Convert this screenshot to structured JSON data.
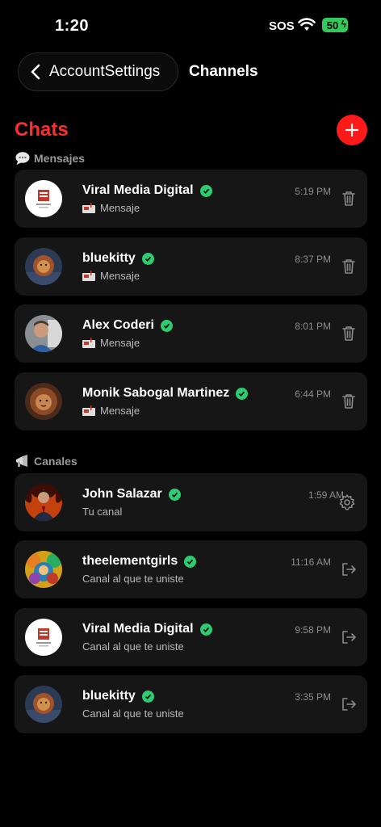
{
  "status_bar": {
    "time": "1:20",
    "carrier": "SOS",
    "battery": "50"
  },
  "header": {
    "back_label": "AccountSettings",
    "title": "Channels"
  },
  "page_title": "Chats",
  "sections": {
    "messages_label": "Mensajes",
    "channels_label": "Canales"
  },
  "messages": [
    {
      "name": "Viral Media Digital",
      "subtitle": "Mensaje",
      "time": "5:19 PM",
      "avatar": "viral-media-logo",
      "action": "trash-icon"
    },
    {
      "name": "bluekitty",
      "subtitle": "Mensaje",
      "time": "8:37 PM",
      "avatar": "lion-image",
      "action": "trash-icon"
    },
    {
      "name": "Alex Coderi",
      "subtitle": "Mensaje",
      "time": "8:01 PM",
      "avatar": "man-photo",
      "action": "trash-icon"
    },
    {
      "name": "Monik Sabogal Martinez",
      "subtitle": "Mensaje",
      "time": "6:44 PM",
      "avatar": "lion-artwork",
      "action": "trash-icon"
    }
  ],
  "channels": [
    {
      "name": "John Salazar",
      "subtitle": "Tu canal",
      "time": "1:59 AM",
      "avatar": "man-suit-fire",
      "action": "gear-icon"
    },
    {
      "name": "theelementgirls",
      "subtitle": "Canal al que te uniste",
      "time": "11:16 AM",
      "avatar": "colorful-girls",
      "action": "leave-icon"
    },
    {
      "name": "Viral Media Digital",
      "subtitle": "Canal al que te uniste",
      "time": "9:58 PM",
      "avatar": "viral-media-logo",
      "action": "leave-icon"
    },
    {
      "name": "bluekitty",
      "subtitle": "Canal al que te uniste",
      "time": "3:35 PM",
      "avatar": "lion-image",
      "action": "leave-icon"
    }
  ],
  "colors": {
    "accent": "#ff1a1a",
    "verified": "#2ecc71",
    "card": "#161616"
  }
}
